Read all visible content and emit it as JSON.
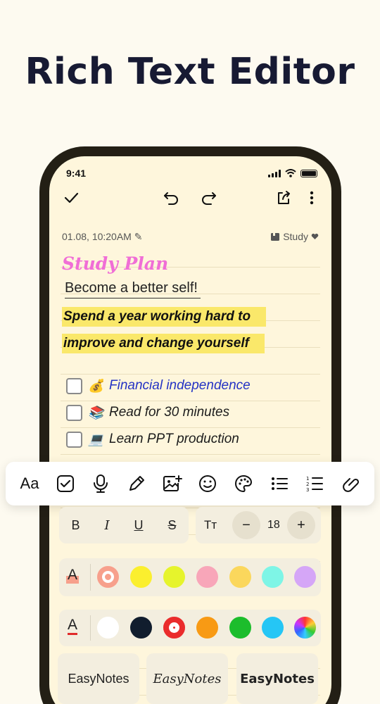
{
  "headline": "Rich Text Editor",
  "status": {
    "time": "9:41"
  },
  "note": {
    "date": "01.08, 10:20AM",
    "folder": "Study",
    "title": "Study Plan",
    "subtitle": "Become a better self!",
    "highlight_lines": [
      "Spend a year working hard to",
      "improve and change yourself"
    ],
    "todos": [
      {
        "emoji": "💰",
        "text": "Financial independence",
        "checked": true,
        "color": "#2433c4"
      },
      {
        "emoji": "📚",
        "text": "Read for 30 minutes",
        "checked": false,
        "color": "#1c1c1c"
      },
      {
        "emoji": "💻",
        "text": "Learn PPT production",
        "checked": false,
        "color": "#1c1c1c"
      }
    ]
  },
  "toolbar": {
    "font_label": "Aa",
    "items": [
      "font",
      "checkbox-icon",
      "microphone-icon",
      "pen-icon",
      "add-image-icon",
      "emoji-icon",
      "palette-icon",
      "bullet-list-icon",
      "numbered-list-icon",
      "link-icon"
    ]
  },
  "format": {
    "bold": "B",
    "italic": "I",
    "underline": "U",
    "strike": "S",
    "size_icon": "Tт",
    "minus": "−",
    "font_size": "18",
    "plus": "+"
  },
  "highlight_colors": [
    "#f7a08c",
    "#fbef2e",
    "#e6f42c",
    "#f8a6b9",
    "#fbd75c",
    "#7ef5e6",
    "#d5a6f7"
  ],
  "text_colors": [
    "#ffffff",
    "#111d2e",
    "#ea2c2c",
    "#f89a14",
    "#1cbd2c",
    "#25c6f5",
    "rainbow"
  ],
  "font_styles": [
    "EasyNotes",
    "EasyNotes",
    "EasyNotes"
  ]
}
